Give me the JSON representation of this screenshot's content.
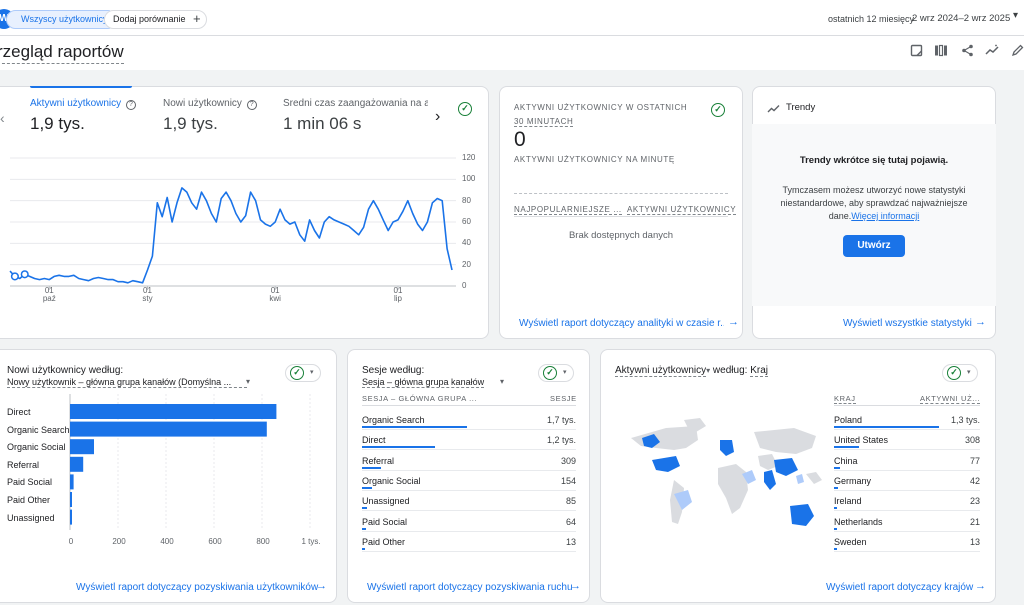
{
  "topbar": {
    "avatar_letter": "W",
    "segment_chip": "Wszyscy użytkownicy",
    "compare_chip": "Dodaj porównanie",
    "date_range_label": "ostatnich 12 miesięcy",
    "date_range": "2 wrz 2024–2 wrz 2025"
  },
  "page": {
    "title": "rzegląd raportów"
  },
  "kpi": {
    "items": [
      {
        "label": "Aktywni użytkownicy",
        "value": "1,9 tys."
      },
      {
        "label": "Nowi użytkownicy",
        "value": "1,9 tys."
      },
      {
        "label": "Średni czas zaangażowania na akty",
        "value": "1 min 06 s"
      }
    ],
    "chart_data": {
      "type": "line",
      "yticks": [
        "120",
        "100",
        "80",
        "60",
        "40",
        "20",
        "0"
      ],
      "ylim": [
        0,
        120
      ],
      "xticks": [
        {
          "day": "01",
          "month": "paź",
          "index": 8
        },
        {
          "day": "01",
          "month": "sty",
          "index": 28
        },
        {
          "day": "01",
          "month": "kwi",
          "index": 54
        },
        {
          "day": "01",
          "month": "lip",
          "index": 79
        }
      ],
      "values": [
        14,
        9,
        7,
        11,
        9,
        7,
        6,
        7,
        6,
        9,
        10,
        9,
        9,
        10,
        7,
        6,
        5,
        7,
        8,
        7,
        6,
        6,
        4,
        4,
        3,
        5,
        4,
        3,
        15,
        28,
        78,
        65,
        83,
        60,
        78,
        92,
        88,
        78,
        72,
        88,
        80,
        68,
        60,
        82,
        88,
        80,
        68,
        60,
        66,
        88,
        80,
        62,
        58,
        56,
        60,
        72,
        62,
        58,
        60,
        48,
        42,
        62,
        52,
        45,
        60,
        65,
        62,
        60,
        58,
        56,
        52,
        48,
        55,
        72,
        80,
        72,
        62,
        52,
        60,
        62,
        70,
        80,
        68,
        58,
        52,
        60,
        78,
        82,
        80,
        35,
        15
      ]
    }
  },
  "realtime": {
    "title_line1": "AKTYWNI UŻYTKOWNICY W OSTATNICH",
    "title_line2": "30 MINUTACH",
    "value": "0",
    "per_minute": "AKTYWNI UŻYTKOWNICY NA MINUTĘ",
    "col1": "NAJPOPULARNIEJSZE ...",
    "col2": "AKTYWNI UŻYTKOWNICY",
    "empty": "Brak dostępnych danych",
    "link": "Wyświetl raport dotyczący analityki w czasie r..."
  },
  "trends": {
    "title": "Trendy",
    "headline": "Trendy wkrótce się tutaj pojawią.",
    "body_line1": "Tymczasem możesz utworzyć nowe statystyki",
    "body_line2": "niestandardowe, aby sprawdzać najważniejsze",
    "body_line3": "dane.",
    "more_link": "Więcej informacji",
    "button": "Utwórz",
    "link": "Wyświetl wszystkie statystyki"
  },
  "new_users": {
    "title": "Nowi użytkownicy według:",
    "subtitle": "Nowy użytkownik – główna grupa kanałów (Domyślna ...",
    "link": "Wyświetl raport dotyczący pozyskiwania użytkowników",
    "chart_data": {
      "type": "bar",
      "categories": [
        "Direct",
        "Organic Search",
        "Organic Social",
        "Referral",
        "Paid Social",
        "Paid Other",
        "Unassigned"
      ],
      "values": [
        860,
        820,
        100,
        55,
        15,
        8,
        5
      ],
      "xticks": [
        "0",
        "200",
        "400",
        "600",
        "800",
        "1 tys."
      ],
      "xlim": [
        0,
        1000
      ]
    }
  },
  "sessions": {
    "title": "Sesje według:",
    "subtitle": "Sesja – główna grupa kanałów",
    "col1": "SESJA – GŁÓWNA GRUPA ...",
    "col2": "SESJE",
    "rows": [
      {
        "name": "Organic Search",
        "value": "1,7 tys.",
        "share": 0.49
      },
      {
        "name": "Direct",
        "value": "1,2 tys.",
        "share": 0.34
      },
      {
        "name": "Referral",
        "value": "309",
        "share": 0.09
      },
      {
        "name": "Organic Social",
        "value": "154",
        "share": 0.045
      },
      {
        "name": "Unassigned",
        "value": "85",
        "share": 0.025
      },
      {
        "name": "Paid Social",
        "value": "64",
        "share": 0.02
      },
      {
        "name": "Paid Other",
        "value": "13",
        "share": 0.005
      }
    ],
    "link": "Wyświetl raport dotyczący pozyskiwania ruchu"
  },
  "countries": {
    "title_prefix": "Aktywni użytkownicy",
    "title_mid": " według: ",
    "title_dim": "Kraj",
    "col1": "KRAJ",
    "col2": "AKTYWNI UŻ...",
    "rows": [
      {
        "name": "Poland",
        "value": "1,3 tys.",
        "share": 0.72
      },
      {
        "name": "United States",
        "value": "308",
        "share": 0.17
      },
      {
        "name": "China",
        "value": "77",
        "share": 0.04
      },
      {
        "name": "Germany",
        "value": "42",
        "share": 0.025
      },
      {
        "name": "Ireland",
        "value": "23",
        "share": 0.013
      },
      {
        "name": "Netherlands",
        "value": "21",
        "share": 0.012
      },
      {
        "name": "Sweden",
        "value": "13",
        "share": 0.007
      }
    ],
    "link": "Wyświetl raport dotyczący krajów"
  },
  "colors": {
    "accent": "#1a73e8",
    "check": "#188038",
    "map_light": "#aecbfa",
    "map_empty": "#dadce0"
  }
}
